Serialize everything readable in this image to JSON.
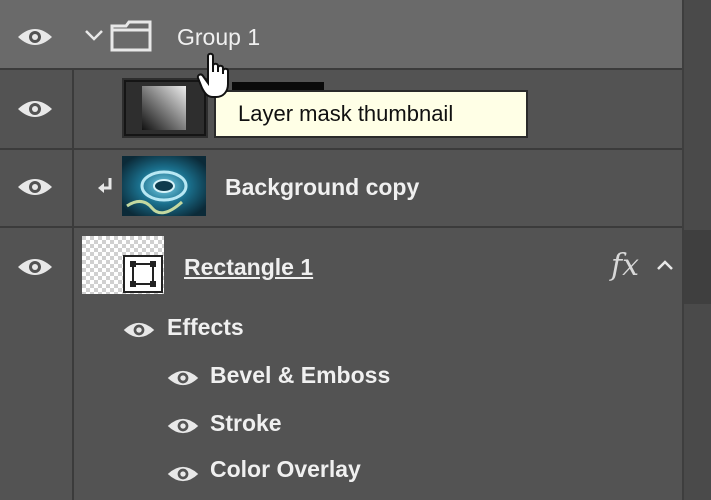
{
  "layers": {
    "group": {
      "name": "Group 1"
    },
    "mask_tooltip": "Layer mask thumbnail",
    "background_copy": {
      "name": "Background copy"
    },
    "rectangle": {
      "name": "Rectangle 1",
      "fx_label": "fx"
    },
    "effects": {
      "header": "Effects",
      "items": [
        "Bevel & Emboss",
        "Stroke",
        "Color Overlay"
      ]
    }
  },
  "colors": {
    "panel_bg": "#535353",
    "selected_row": "#6a6a6a",
    "tooltip_bg": "#ffffe6"
  },
  "icons": [
    "eye-icon",
    "chevron-down-icon",
    "folder-icon",
    "clip-arrow-icon",
    "hand-cursor-icon",
    "chevron-up-icon"
  ]
}
